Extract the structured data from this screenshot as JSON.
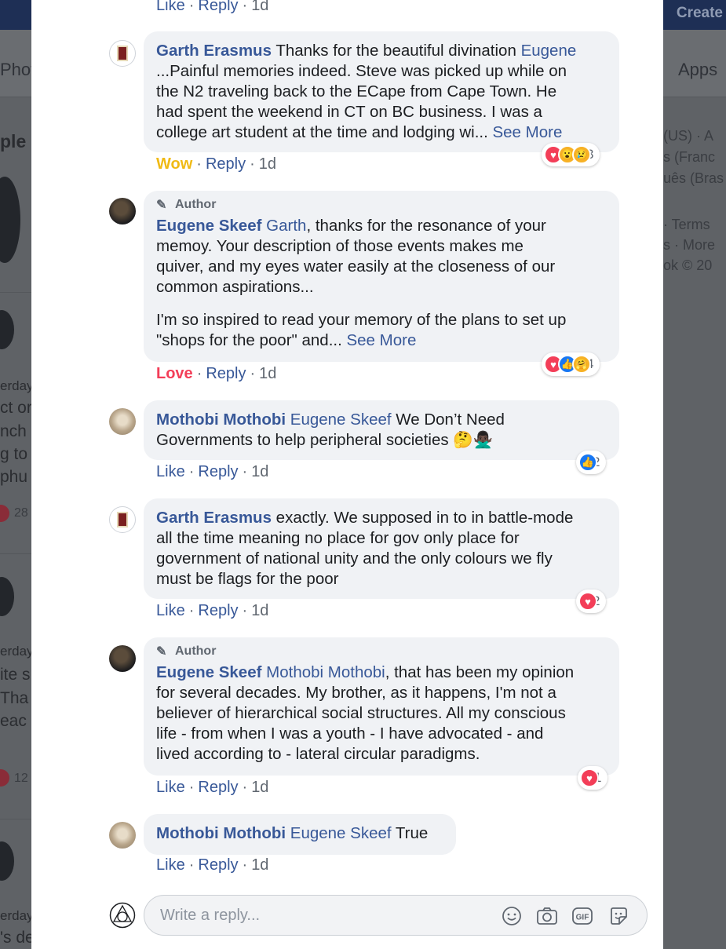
{
  "background": {
    "create_label": "Create",
    "apps_label": "Apps",
    "photos_fragment": "Phot",
    "left_fragments": [
      "ple",
      "erday",
      "ct or",
      "nch",
      "g to",
      "phu",
      "erday",
      "ite s",
      "Tha",
      "eac",
      "erday",
      "'s de"
    ],
    "left_numbers": [
      "28",
      "12"
    ],
    "right_fragments": [
      "(US) · A",
      "s (Franc",
      "uês (Bras",
      "· Terms",
      "s · More",
      "ok © 20"
    ]
  },
  "comments": [
    {
      "author": "Garth Erasmus",
      "is_author": false,
      "mention": "Eugene",
      "text_lines": [
        "...Painful memories indeed. Steve was picked up while on",
        "the N2 traveling back to the ECape from Cape Town. He",
        "had spent the weekend in CT on BC business. I was a",
        "college art student at the time and lodging wi... "
      ],
      "first_line": "Thanks for the beautiful divination ",
      "see_more": "See More",
      "reaction_label": "Wow",
      "reply_label": "Reply",
      "time": "1d",
      "reaction_count": "3",
      "reaction_icons": [
        "love",
        "wow",
        "sad"
      ]
    },
    {
      "author": "Eugene Skeef",
      "is_author": true,
      "author_badge": "Author",
      "mention": "Garth",
      "text_p1": [
        ", thanks for the resonance of your",
        "memoy. Your description of those events makes me",
        "quiver, and my eyes water easily at the closeness of our",
        "common aspirations..."
      ],
      "text_p2": [
        "I'm so inspired to read your memory of the plans to set up",
        "\"shops for the poor\" and... "
      ],
      "see_more": "See More",
      "reaction_label": "Love",
      "reply_label": "Reply",
      "time": "1d",
      "reaction_count": "4",
      "reaction_icons": [
        "love",
        "like",
        "care"
      ]
    },
    {
      "author": "Mothobi Mothobi",
      "is_author": false,
      "mention": "Eugene Skeef",
      "text_line1": " We Don’t Need",
      "text_line2": "Governments to help peripheral societies 🤔🙅🏿‍♂️",
      "reaction_label": "Like",
      "reply_label": "Reply",
      "time": "1d",
      "reaction_count": "2",
      "reaction_icons": [
        "like"
      ]
    },
    {
      "author": "Garth Erasmus",
      "is_author": false,
      "text_first": " exactly. We supposed in to in battle-mode",
      "text_lines": [
        "all the time meaning no place for gov only place for",
        "government of national unity and the only colours we fly",
        "must be flags for the poor"
      ],
      "reaction_label": "Like",
      "reply_label": "Reply",
      "time": "1d",
      "reaction_count": "2",
      "reaction_icons": [
        "love"
      ]
    },
    {
      "author": "Eugene Skeef",
      "is_author": true,
      "author_badge": "Author",
      "mention": "Mothobi Mothobi",
      "text_first": ", that has been my opinion",
      "text_lines": [
        "for several decades. My brother, as it happens, I'm not a",
        "believer of hierarchical social structures. All my conscious",
        "life - from when I was a youth - I have advocated - and",
        "lived according to - lateral circular paradigms."
      ],
      "reaction_label": "Like",
      "reply_label": "Reply",
      "time": "1d",
      "reaction_count": "1",
      "reaction_icons": [
        "love"
      ]
    },
    {
      "author": "Mothobi Mothobi",
      "is_author": false,
      "mention": "Eugene Skeef",
      "text": " True",
      "reaction_label": "Like",
      "reply_label": "Reply",
      "time": "1d"
    }
  ],
  "top_actions": {
    "like_label": "Like",
    "reply_label": "Reply",
    "time": "1d"
  },
  "composer": {
    "placeholder": "Write a reply...",
    "icons": [
      "emoji-icon",
      "camera-icon",
      "gif-icon",
      "sticker-icon"
    ]
  },
  "separator": "·"
}
